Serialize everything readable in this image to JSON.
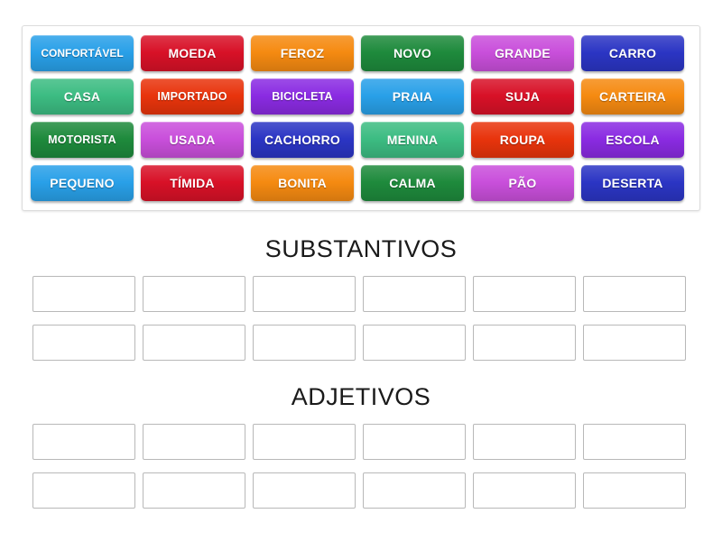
{
  "page": {
    "background": "#ffffff",
    "activity_type": "group-sort"
  },
  "word_bank": {
    "name": "word-bank",
    "rows": [
      [
        {
          "label": "CONFORTÁVEL",
          "color": "#29A0E8",
          "color_name": "sky-blue"
        },
        {
          "label": "MOEDA",
          "color": "#D81127",
          "color_name": "crimson"
        },
        {
          "label": "FEROZ",
          "color": "#F58A11",
          "color_name": "orange"
        },
        {
          "label": "NOVO",
          "color": "#1E8A3C",
          "color_name": "dark-green"
        },
        {
          "label": "GRANDE",
          "color": "#C94FDB",
          "color_name": "orchid"
        },
        {
          "label": "CARRO",
          "color": "#2B35C4",
          "color_name": "royal-blue"
        }
      ],
      [
        {
          "label": "CASA",
          "color": "#3CBC82",
          "color_name": "sea-green"
        },
        {
          "label": "IMPORTADO",
          "color": "#E8340C",
          "color_name": "red-orange"
        },
        {
          "label": "BICICLETA",
          "color": "#8A2BE2",
          "color_name": "violet"
        },
        {
          "label": "PRAIA",
          "color": "#29A0E8",
          "color_name": "sky-blue"
        },
        {
          "label": "SUJA",
          "color": "#D81127",
          "color_name": "crimson"
        },
        {
          "label": "CARTEIRA",
          "color": "#F58A11",
          "color_name": "orange"
        }
      ],
      [
        {
          "label": "MOTORISTA",
          "color": "#1E8A3C",
          "color_name": "dark-green"
        },
        {
          "label": "USADA",
          "color": "#C94FDB",
          "color_name": "orchid"
        },
        {
          "label": "CACHORRO",
          "color": "#2B35C4",
          "color_name": "royal-blue"
        },
        {
          "label": "MENINA",
          "color": "#3CBC82",
          "color_name": "sea-green"
        },
        {
          "label": "ROUPA",
          "color": "#E8340C",
          "color_name": "red-orange"
        },
        {
          "label": "ESCOLA",
          "color": "#8A2BE2",
          "color_name": "violet"
        }
      ],
      [
        {
          "label": "PEQUENO",
          "color": "#29A0E8",
          "color_name": "sky-blue"
        },
        {
          "label": "TÍMIDA",
          "color": "#D81127",
          "color_name": "crimson"
        },
        {
          "label": "BONITA",
          "color": "#F58A11",
          "color_name": "orange"
        },
        {
          "label": "CALMA",
          "color": "#1E8A3C",
          "color_name": "dark-green"
        },
        {
          "label": "PÃO",
          "color": "#C94FDB",
          "color_name": "orchid"
        },
        {
          "label": "DESERTA",
          "color": "#2B35C4",
          "color_name": "royal-blue"
        }
      ]
    ]
  },
  "groups": [
    {
      "title": "SUBSTANTIVOS",
      "slot_rows": [
        [
          "",
          "",
          "",
          "",
          "",
          ""
        ],
        [
          "",
          "",
          "",
          "",
          "",
          ""
        ]
      ]
    },
    {
      "title": "ADJETIVOS",
      "slot_rows": [
        [
          "",
          "",
          "",
          "",
          "",
          ""
        ],
        [
          "",
          "",
          "",
          "",
          "",
          ""
        ]
      ]
    }
  ]
}
